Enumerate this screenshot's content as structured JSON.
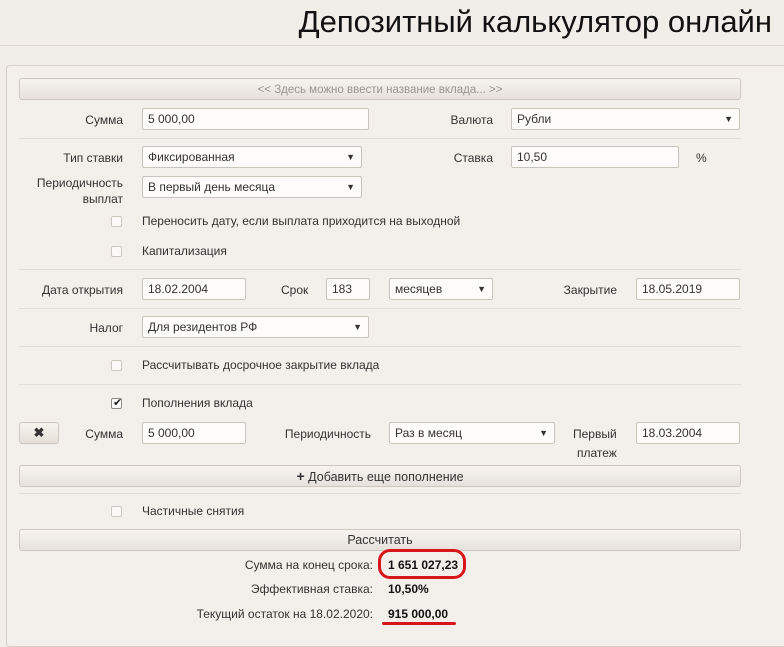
{
  "page": {
    "title": "Депозитный калькулятор онлайн"
  },
  "form": {
    "deposit_name_placeholder": "<< Здесь можно ввести название вклада... >>",
    "amount_label": "Сумма",
    "amount_value": "5 000,00",
    "currency_label": "Валюта",
    "currency_value": "Рубли",
    "rate_type_label": "Тип ставки",
    "rate_type_value": "Фиксированная",
    "rate_label": "Ставка",
    "rate_value": "10,50",
    "rate_unit": "%",
    "payout_period_label_1": "Периодичность",
    "payout_period_label_2": "выплат",
    "payout_period_value": "В первый день месяца",
    "weekend_shift_label": "Переносить дату, если выплата приходится на выходной",
    "weekend_shift_checked": false,
    "capitalization_label": "Капитализация",
    "capitalization_checked": false,
    "open_date_label": "Дата открытия",
    "open_date_value": "18.02.2004",
    "term_label": "Срок",
    "term_value": "183",
    "term_unit_value": "месяцев",
    "close_date_label": "Закрытие",
    "close_date_value": "18.05.2019",
    "tax_label": "Налог",
    "tax_value": "Для резидентов РФ",
    "early_close_label": "Рассчитывать досрочное закрытие вклада",
    "early_close_checked": false,
    "replenish_label": "Пополнения вклада",
    "replenish_checked": true,
    "replenish_amount_label": "Сумма",
    "replenish_amount_value": "5 000,00",
    "replenish_period_label": "Периодичность",
    "replenish_period_value": "Раз в месяц",
    "first_payment_label_1": "Первый",
    "first_payment_label_2": "платеж",
    "first_payment_value": "18.03.2004",
    "delete_replenish_symbol": "✖",
    "add_replenish_label": "Добавить еще пополнение",
    "withdrawals_label": "Частичные снятия",
    "withdrawals_checked": false,
    "calculate_label": "Рассчитать"
  },
  "results": {
    "final_sum_label": "Сумма на конец срока:",
    "final_sum_value": "1 651 027,23",
    "effective_rate_label": "Эффективная ставка:",
    "effective_rate_value": "10,50%",
    "current_balance_label": "Текущий остаток на 18.02.2020:",
    "current_balance_value": "915 000,00"
  },
  "colors": {
    "highlight": "#d8151b",
    "background": "#f1ede8"
  },
  "icons": {
    "dropdown": "chevron-down-icon",
    "check": "checkmark-icon",
    "plus": "plus-icon",
    "close": "close-icon"
  }
}
